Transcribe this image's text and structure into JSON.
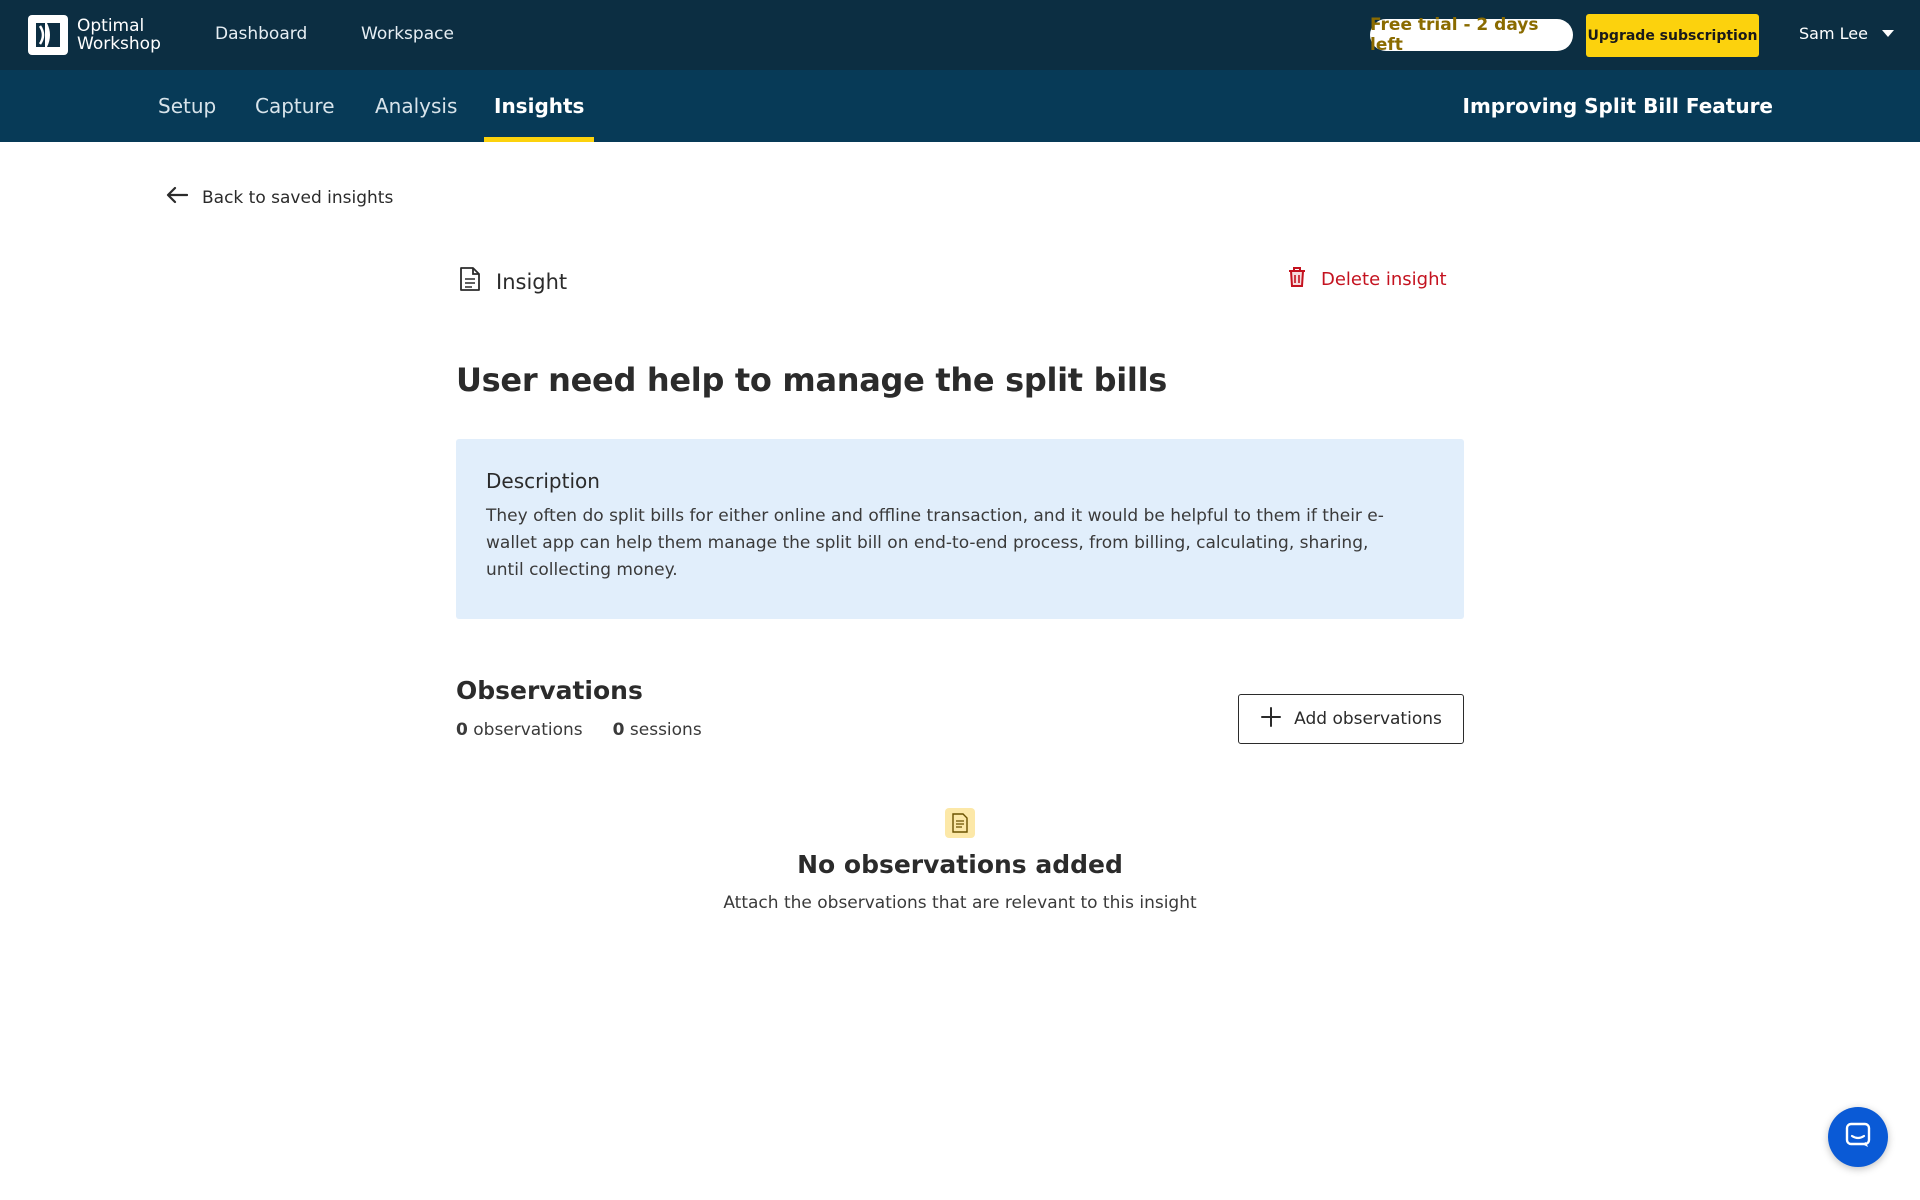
{
  "header": {
    "logo_line1": "Optimal",
    "logo_line2": "Workshop",
    "nav": [
      {
        "label": "Dashboard"
      },
      {
        "label": "Workspace"
      }
    ],
    "trial_badge": "Free trial - 2 days left",
    "upgrade_label": "Upgrade subscription",
    "user_name": "Sam Lee"
  },
  "subnav": {
    "tabs": [
      {
        "label": "Setup"
      },
      {
        "label": "Capture"
      },
      {
        "label": "Analysis"
      },
      {
        "label": "Insights",
        "active": true
      }
    ],
    "project_title": "Improving Split Bill Feature"
  },
  "content": {
    "back_label": "Back to saved insights",
    "section_label": "Insight",
    "delete_label": "Delete insight",
    "title": "User need help to manage the split bills",
    "description": {
      "heading": "Description",
      "body": "They often do split bills for either online and offline transaction, and it would be helpful to them if their e-wallet app can help them manage the split bill on end-to-end process, from billing, calculating, sharing, until collecting money."
    },
    "observations": {
      "heading": "Observations",
      "obs_count": "0",
      "obs_label": "observations",
      "session_count": "0",
      "session_label": "sessions",
      "add_label": "Add observations",
      "empty_title": "No observations added",
      "empty_subtitle": "Attach the observations that are relevant to this insight"
    }
  },
  "colors": {
    "topbar": "#0c2e42",
    "subnav": "#073a57",
    "accent_yellow": "#fcd20d",
    "danger": "#c4121f",
    "description_bg": "#e1eefb",
    "chat_button": "#0a5ad6"
  },
  "icons": [
    "logo-icon",
    "caret-down-icon",
    "arrow-left-icon",
    "document-icon",
    "trash-icon",
    "plus-icon",
    "chat-icon"
  ]
}
